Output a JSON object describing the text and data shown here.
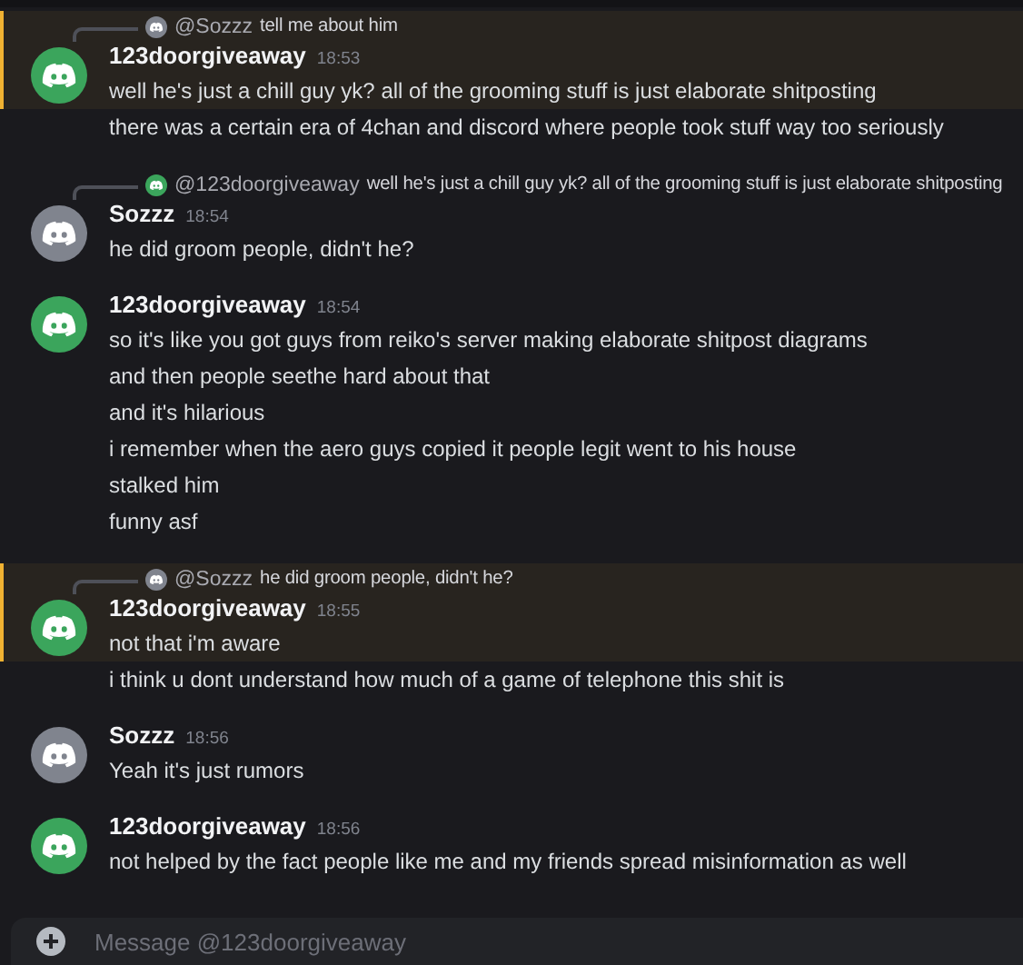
{
  "messages": [
    {
      "author": "123doorgiveaway",
      "color": "#3ba55c",
      "time": "18:53",
      "reply": {
        "author": "@Sozzz",
        "color": "#80848e",
        "text": "tell me about him"
      },
      "lines": [
        {
          "text": "well he's just a chill guy yk? all of the grooming stuff is just elaborate shitposting",
          "mentioned": true
        },
        {
          "text": "there was a certain era of 4chan and discord where people took stuff way too seriously",
          "mentioned": false
        }
      ]
    },
    {
      "author": "Sozzz",
      "color": "#80848e",
      "time": "18:54",
      "reply": {
        "author": "@123doorgiveaway",
        "color": "#3ba55c",
        "text": "well he's just a chill guy yk? all of the grooming stuff is just elaborate shitposting"
      },
      "lines": [
        {
          "text": "he did groom people, didn't he?",
          "mentioned": false
        }
      ]
    },
    {
      "author": "123doorgiveaway",
      "color": "#3ba55c",
      "time": "18:54",
      "lines": [
        {
          "text": "so it's like you got guys from reiko's server making elaborate shitpost diagrams",
          "mentioned": false
        },
        {
          "text": "and then people seethe hard about that",
          "mentioned": false
        },
        {
          "text": "and it's hilarious",
          "mentioned": false
        },
        {
          "text": "i remember when the aero guys copied it people legit went to his house",
          "mentioned": false
        },
        {
          "text": "stalked him",
          "mentioned": false
        },
        {
          "text": "funny asf",
          "mentioned": false
        }
      ]
    },
    {
      "author": "123doorgiveaway",
      "color": "#3ba55c",
      "time": "18:55",
      "reply": {
        "author": "@Sozzz",
        "color": "#80848e",
        "text": "he did groom people, didn't he?"
      },
      "lines": [
        {
          "text": "not that i'm aware",
          "mentioned": true
        },
        {
          "text": "i think u dont understand how much of a game of telephone this shit is",
          "mentioned": false
        }
      ]
    },
    {
      "author": "Sozzz",
      "color": "#80848e",
      "time": "18:56",
      "lines": [
        {
          "text": "Yeah it's just rumors",
          "mentioned": false
        }
      ]
    },
    {
      "author": "123doorgiveaway",
      "color": "#3ba55c",
      "time": "18:56",
      "lines": [
        {
          "text": "not helped by the fact people like me and my friends spread misinformation as well",
          "mentioned": false
        }
      ]
    }
  ],
  "composer": {
    "placeholder": "Message @123doorgiveaway"
  }
}
